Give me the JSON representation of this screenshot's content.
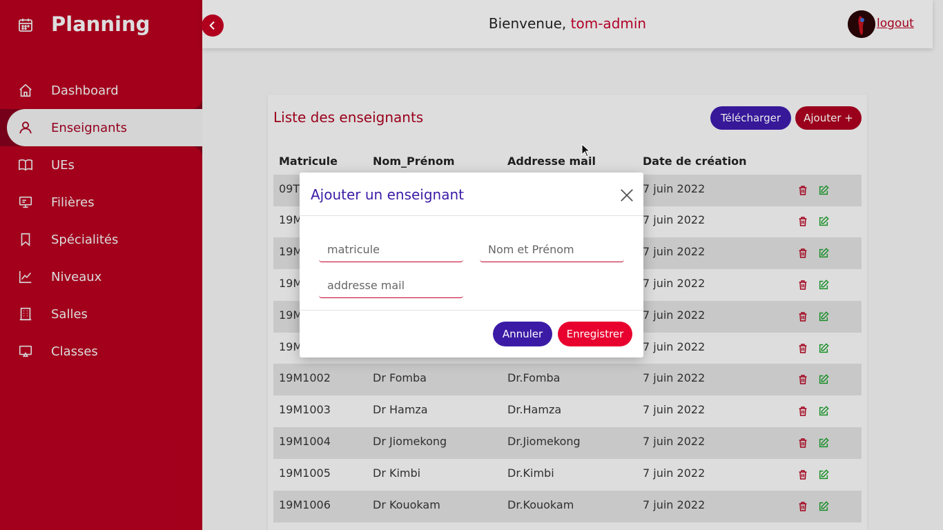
{
  "app": {
    "title": "Planning"
  },
  "sidebar": {
    "items": [
      {
        "label": "Dashboard",
        "icon": "home-icon"
      },
      {
        "label": "Enseignants",
        "icon": "user-icon",
        "active": true
      },
      {
        "label": "UEs",
        "icon": "book-icon"
      },
      {
        "label": "Filières",
        "icon": "presentation-icon"
      },
      {
        "label": "Spécialités",
        "icon": "bookmark-icon"
      },
      {
        "label": "Niveaux",
        "icon": "chart-line-icon"
      },
      {
        "label": "Salles",
        "icon": "building-icon"
      },
      {
        "label": "Classes",
        "icon": "screen-icon"
      }
    ]
  },
  "header": {
    "welcome": "Bienvenue,",
    "username": "tom-admin",
    "logout": "logout"
  },
  "main": {
    "title": "Liste des enseignants",
    "download_label": "Télécharger",
    "add_label": "Ajouter +",
    "columns": [
      "Matricule",
      "Nom_Prénom",
      "Addresse mail",
      "Date de création"
    ],
    "rows": [
      {
        "matricule": "09T",
        "nom": "",
        "mail": "",
        "date": "7 juin 2022"
      },
      {
        "matricule": "19M",
        "nom": "",
        "mail": "",
        "date": "7 juin 2022"
      },
      {
        "matricule": "19M",
        "nom": "",
        "mail": "",
        "date": "7 juin 2022"
      },
      {
        "matricule": "19M",
        "nom": "",
        "mail": "",
        "date": "7 juin 2022"
      },
      {
        "matricule": "19M",
        "nom": "",
        "mail": "",
        "date": "7 juin 2022"
      },
      {
        "matricule": "19M",
        "nom": "",
        "mail": "",
        "date": "7 juin 2022"
      },
      {
        "matricule": "19M1002",
        "nom": "Dr Fomba",
        "mail": "Dr.Fomba",
        "date": "7 juin 2022"
      },
      {
        "matricule": "19M1003",
        "nom": "Dr Hamza",
        "mail": "Dr.Hamza",
        "date": "7 juin 2022"
      },
      {
        "matricule": "19M1004",
        "nom": "Dr Jiomekong",
        "mail": "Dr.Jiomekong",
        "date": "7 juin 2022"
      },
      {
        "matricule": "19M1005",
        "nom": "Dr Kimbi",
        "mail": "Dr.Kimbi",
        "date": "7 juin 2022"
      },
      {
        "matricule": "19M1006",
        "nom": "Dr Kouokam",
        "mail": "Dr.Kouokam",
        "date": "7 juin 2022"
      }
    ]
  },
  "modal": {
    "title": "Ajouter un enseignant",
    "matricule_placeholder": "matricule",
    "nom_placeholder": "Nom et Prénom",
    "mail_placeholder": "addresse mail",
    "cancel_label": "Annuler",
    "save_label": "Enregistrer"
  },
  "colors": {
    "primary": "#b0001e",
    "accent": "#3b1ba6",
    "save": "#e8002e",
    "edit": "#1a9a2a"
  }
}
